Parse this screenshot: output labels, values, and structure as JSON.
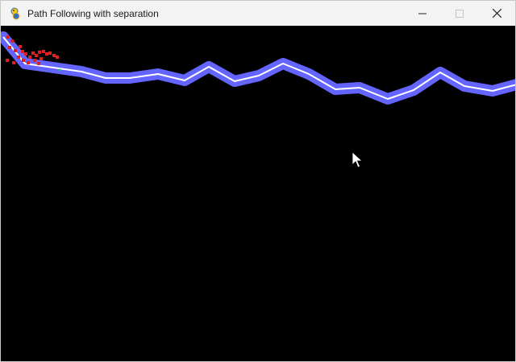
{
  "window": {
    "title": "Path Following with separation",
    "app_icon": "pygame-snake-icon",
    "controls": [
      "minimize-icon",
      "maximize-icon",
      "close-icon"
    ]
  },
  "colors": {
    "background": "#000000",
    "path_band": "#6464ff",
    "path_center": "#ffffff",
    "vehicle": "#e02020",
    "target": "#22c55e",
    "cursor": "#ffffff"
  }
}
